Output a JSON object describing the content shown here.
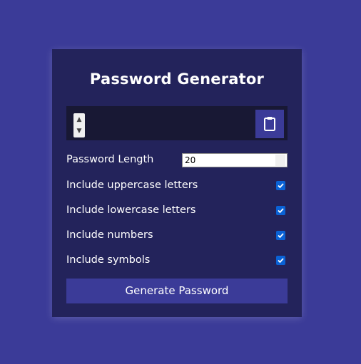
{
  "title": "Password Generator",
  "result": {
    "value": ""
  },
  "icons": {
    "clipboard": "clipboard-icon",
    "check": "checkmark-icon"
  },
  "settings": {
    "length_label": "Password Length",
    "length_value": "20",
    "options": [
      {
        "label": "Include uppercase letters",
        "checked": true
      },
      {
        "label": "Include lowercase letters",
        "checked": true
      },
      {
        "label": "Include numbers",
        "checked": true
      },
      {
        "label": "Include symbols",
        "checked": true
      }
    ]
  },
  "generate_button": {
    "label": "Generate Password"
  },
  "colors": {
    "background": "#3b3b98",
    "card": "#23235b",
    "result_box": "#181834",
    "accent": "#3b3b98",
    "checkbox": "#0a62d6"
  }
}
